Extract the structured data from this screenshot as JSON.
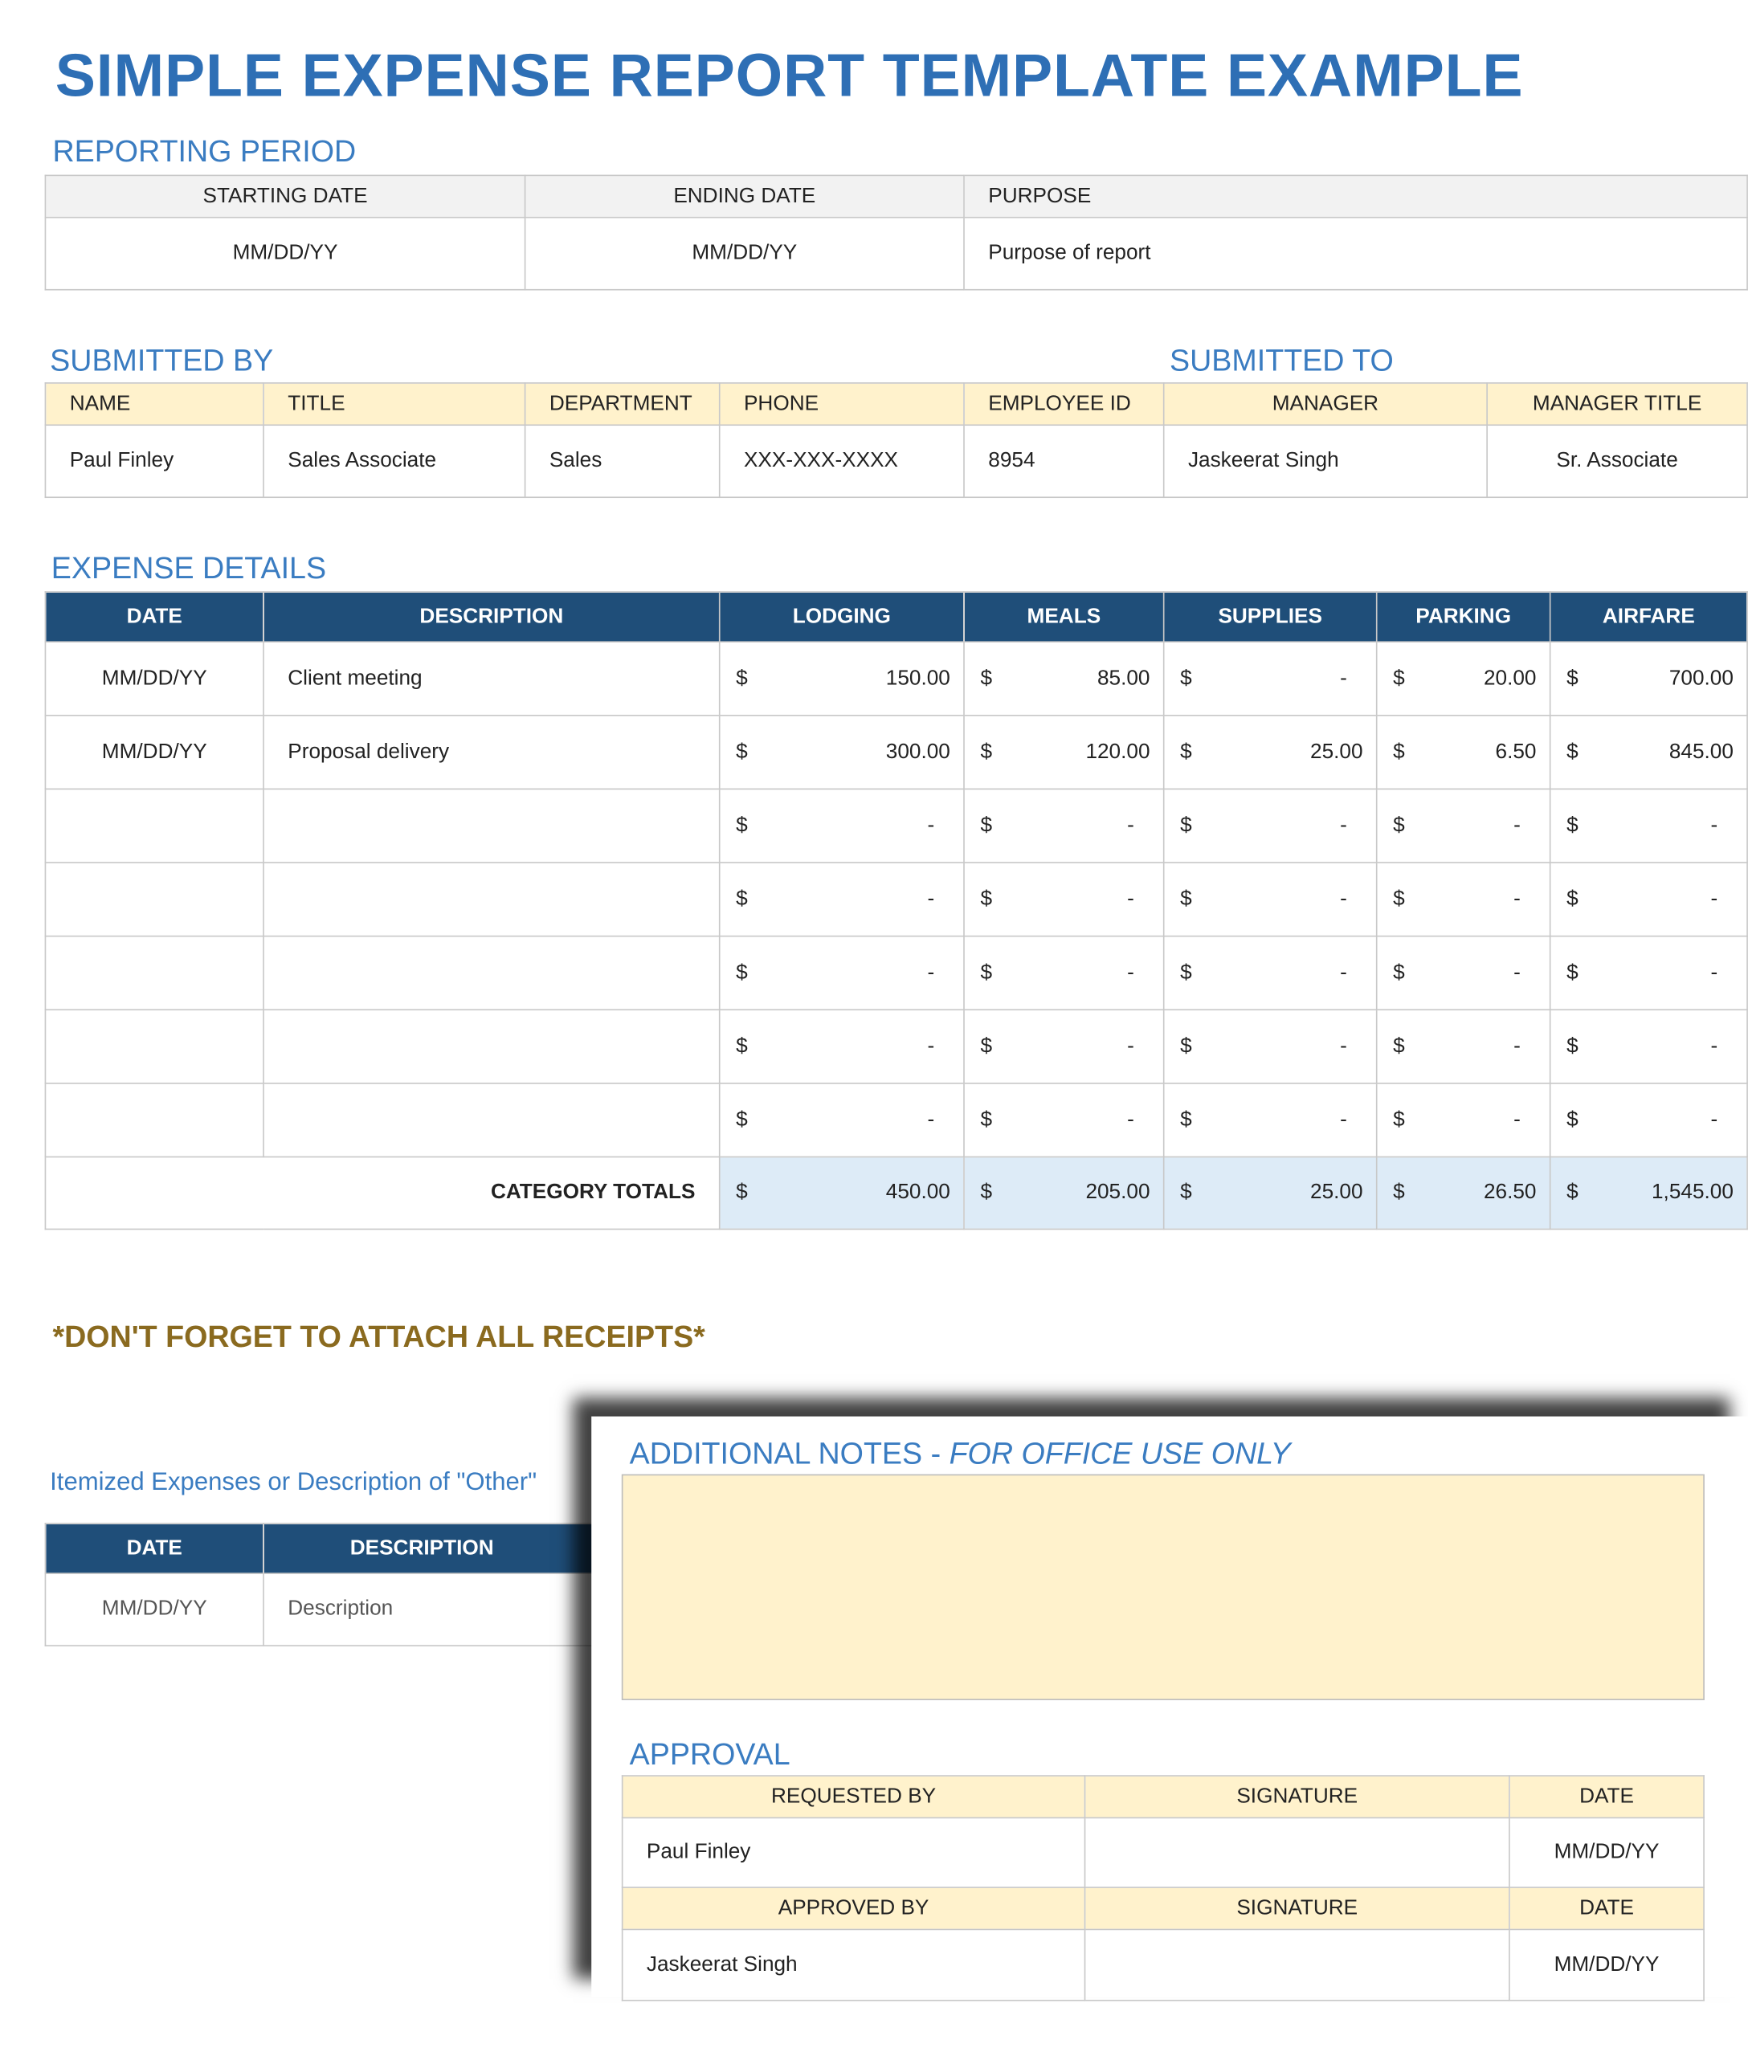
{
  "title": "SIMPLE EXPENSE REPORT TEMPLATE EXAMPLE",
  "reporting_period": {
    "label": "REPORTING PERIOD",
    "headers": [
      "STARTING DATE",
      "ENDING DATE",
      "PURPOSE"
    ],
    "values": [
      "MM/DD/YY",
      "MM/DD/YY",
      "Purpose of report"
    ]
  },
  "submitted_by_label": "SUBMITTED BY",
  "submitted_to_label": "SUBMITTED TO",
  "people": {
    "headers": [
      "NAME",
      "TITLE",
      "DEPARTMENT",
      "PHONE",
      "EMPLOYEE ID",
      "MANAGER",
      "MANAGER TITLE"
    ],
    "values": [
      "Paul Finley",
      "Sales Associate",
      "Sales",
      "XXX-XXX-XXXX",
      "8954",
      "Jaskeerat Singh",
      "Sr. Associate"
    ]
  },
  "expense": {
    "label": "EXPENSE DETAILS",
    "headers": [
      "DATE",
      "DESCRIPTION",
      "LODGING",
      "MEALS",
      "SUPPLIES",
      "PARKING",
      "AIRFARE"
    ],
    "currency": "$",
    "rows": [
      {
        "date": "MM/DD/YY",
        "desc": "Client meeting",
        "amounts": [
          "150.00",
          "85.00",
          "-",
          "20.00",
          "700.00"
        ]
      },
      {
        "date": "MM/DD/YY",
        "desc": "Proposal delivery",
        "amounts": [
          "300.00",
          "120.00",
          "25.00",
          "6.50",
          "845.00"
        ]
      },
      {
        "date": "",
        "desc": "",
        "amounts": [
          "-",
          "-",
          "-",
          "-",
          "-"
        ]
      },
      {
        "date": "",
        "desc": "",
        "amounts": [
          "-",
          "-",
          "-",
          "-",
          "-"
        ]
      },
      {
        "date": "",
        "desc": "",
        "amounts": [
          "-",
          "-",
          "-",
          "-",
          "-"
        ]
      },
      {
        "date": "",
        "desc": "",
        "amounts": [
          "-",
          "-",
          "-",
          "-",
          "-"
        ]
      },
      {
        "date": "",
        "desc": "",
        "amounts": [
          "-",
          "-",
          "-",
          "-",
          "-"
        ]
      }
    ],
    "totals_label": "CATEGORY TOTALS",
    "totals": [
      "450.00",
      "205.00",
      "25.00",
      "26.50",
      "1,545.00"
    ]
  },
  "receipts_note": "*DON'T FORGET TO ATTACH ALL RECEIPTS*",
  "itemized": {
    "label": "Itemized Expenses or Description of \"Other\"",
    "headers": [
      "DATE",
      "DESCRIPTION"
    ],
    "values": [
      "MM/DD/YY",
      "Description"
    ]
  },
  "notes": {
    "label": "ADDITIONAL NOTES - ",
    "label_italic": "FOR OFFICE USE ONLY"
  },
  "approval": {
    "label": "APPROVAL",
    "req_headers": [
      "REQUESTED BY",
      "SIGNATURE",
      "DATE"
    ],
    "req_values": [
      "Paul Finley",
      "",
      "MM/DD/YY"
    ],
    "app_headers": [
      "APPROVED BY",
      "SIGNATURE",
      "DATE"
    ],
    "app_values": [
      "Jaskeerat Singh",
      "",
      "MM/DD/YY"
    ]
  },
  "colors": {
    "title": "#2e6fb5",
    "section": "#3a7cc1",
    "navy": "#1f4e79",
    "yellow": "#fff2cc",
    "totals": "#ddebf7",
    "note": "#8a6a1f"
  }
}
